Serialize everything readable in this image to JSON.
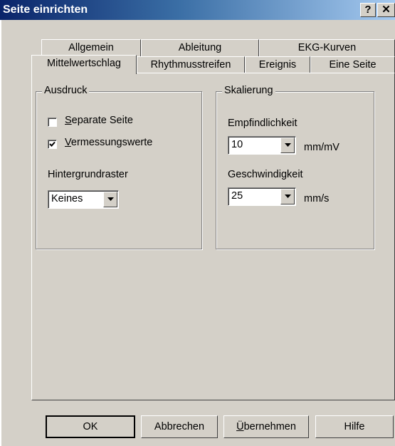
{
  "window": {
    "title": "Seite einrichten",
    "help_button": "?",
    "close_button": "✕"
  },
  "tabs_row_back": [
    {
      "label": "Allgemein"
    },
    {
      "label": "Ableitung"
    },
    {
      "label": "EKG-Kurven"
    }
  ],
  "tabs_row_front": [
    {
      "label": "Mittelwertschlag",
      "active": true
    },
    {
      "label": "Rhythmusstreifen"
    },
    {
      "label": "Ereignis"
    },
    {
      "label": "Eine Seite"
    }
  ],
  "ausdruck": {
    "legend": "Ausdruck",
    "separate_page": {
      "label_mnemonic": "S",
      "label_rest": "eparate Seite",
      "checked": false
    },
    "measurements": {
      "label_mnemonic": "V",
      "label_rest": "ermessungswerte",
      "checked": true
    },
    "grid_label": "Hintergrundraster",
    "grid_value": "Keines"
  },
  "skalierung": {
    "legend": "Skalierung",
    "sensitivity_label": "Empfindlichkeit",
    "sensitivity_value": "10",
    "sensitivity_unit": "mm/mV",
    "speed_label": "Geschwindigkeit",
    "speed_value": "25",
    "speed_unit": "mm/s"
  },
  "buttons": {
    "ok": "OK",
    "cancel": "Abbrechen",
    "apply_mnemonic": "Ü",
    "apply_rest": "bernehmen",
    "help": "Hilfe"
  }
}
